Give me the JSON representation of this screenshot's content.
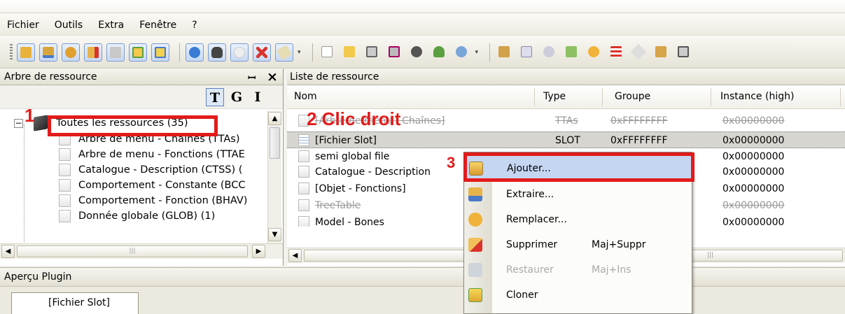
{
  "menubar": {
    "items": [
      {
        "label": "Fichier"
      },
      {
        "label": "Outils"
      },
      {
        "label": "Extra"
      },
      {
        "label": "Fenêtre"
      },
      {
        "label": "?"
      }
    ]
  },
  "left_panel": {
    "title": "Arbre de ressource",
    "pin_glyph": "ꟷ",
    "close_glyph": "×",
    "view_buttons": [
      "T",
      "G",
      "I"
    ],
    "root": "Toutes les ressources (35)",
    "items": [
      "Arbre de menu - Chaînes (TTAs)",
      "Arbre de menu - Fonctions (TTAE",
      "Catalogue - Description (CTSS) (",
      "Comportement - Constante (BCC",
      "Comportement - Fonction (BHAV)",
      "Donnée globale (GLOB) (1)"
    ]
  },
  "right_panel": {
    "title": "Liste de ressource",
    "columns": [
      "Nom",
      "Type",
      "Groupe",
      "Instance (high)"
    ],
    "rows": [
      {
        "nom": "[Arbre de menu - Chaînes]",
        "type": "TTAs",
        "groupe": "0xFFFFFFFF",
        "instance": "0x00000000"
      },
      {
        "nom": "[Fichier Slot]",
        "type": "SLOT",
        "groupe": "0xFFFFFFFF",
        "instance": "0x00000000"
      },
      {
        "nom": "semi global file",
        "type": "",
        "groupe": "",
        "instance": "0x00000000"
      },
      {
        "nom": "Catalogue - Description",
        "type": "",
        "groupe": "",
        "instance": "0x00000000"
      },
      {
        "nom": "[Objet - Fonctions]",
        "type": "",
        "groupe": "",
        "instance": "0x00000000"
      },
      {
        "nom": "TreeTable",
        "type": "",
        "groupe": "",
        "instance": "0x00000000"
      },
      {
        "nom": "Model - Bones",
        "type": "",
        "groupe": "",
        "instance": "0x00000000"
      }
    ]
  },
  "context_menu": {
    "items": [
      {
        "label": "Ajouter...",
        "shortcut": ""
      },
      {
        "label": "Extraire...",
        "shortcut": ""
      },
      {
        "label": "Remplacer...",
        "shortcut": ""
      },
      {
        "label": "Supprimer",
        "shortcut": "Maj+Suppr"
      },
      {
        "label": "Restaurer",
        "shortcut": "Maj+Ins"
      },
      {
        "label": "Cloner",
        "shortcut": ""
      }
    ]
  },
  "bottom": {
    "apercu_title": "Aperçu Plugin",
    "tab_label": "[Fichier Slot]"
  },
  "annotations": {
    "step1": "1",
    "step2": "2 Clic droit",
    "step3": "3"
  },
  "colors": {
    "annotation_red": "#e21b1b",
    "highlight_blue": "#c5d6f2",
    "selection_gray": "#d7d5cf"
  }
}
